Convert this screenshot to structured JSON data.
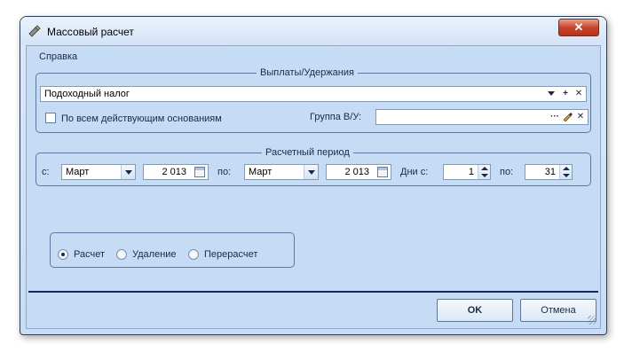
{
  "window": {
    "title": "Массовый расчет",
    "close_glyph": "✕"
  },
  "menu": {
    "items": [
      "Справка"
    ]
  },
  "payments_group": {
    "legend": "Выплаты/Удержания",
    "type_value": "Подоходный налог",
    "all_bases_label": "По всем действующим основаниям",
    "all_bases_checked": false,
    "group_label": "Группа В/У:",
    "group_value": "",
    "add_glyph": "+",
    "clear_glyph": "✕",
    "ellipsis_glyph": "···"
  },
  "period_group": {
    "legend": "Расчетный период",
    "from_label": "с:",
    "from_month": "Март",
    "from_year": "2 013",
    "to_label": "по:",
    "to_month": "Март",
    "to_year": "2 013",
    "days_from_label": "Дни с:",
    "days_from": "1",
    "days_to_label": "по:",
    "days_to": "31"
  },
  "mode_group": {
    "options": [
      "Расчет",
      "Удаление",
      "Перерасчет"
    ],
    "selected": "Расчет"
  },
  "buttons": {
    "ok": "OK",
    "cancel": "Отмена"
  },
  "colors": {
    "accent": "#0e2c6b",
    "background": "#c6dcf5"
  }
}
